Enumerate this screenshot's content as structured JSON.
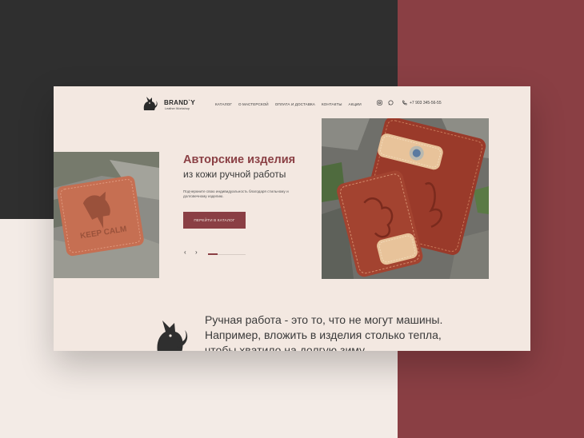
{
  "brand": {
    "name": "BRAND`Y",
    "tagline": "Leather Workshop"
  },
  "nav": {
    "items": [
      {
        "label": "КАТАЛОГ"
      },
      {
        "label": "О МАСТЕРСКОЙ"
      },
      {
        "label": "ОПЛАТА И ДОСТАВКА"
      },
      {
        "label": "КОНТАКТЫ"
      },
      {
        "label": "АКЦИИ"
      }
    ]
  },
  "header": {
    "icons": [
      "instagram-icon",
      "whatsapp-icon",
      "phone-icon"
    ],
    "phone": "+7 903 345-56-55"
  },
  "hero": {
    "title": "Авторские изделия",
    "subtitle": "из кожи ручной работы",
    "description": "Подчеркните свою индивидуальность благодаря стильному и долговечному изделию.",
    "cta_label": "ПЕРЕЙТИ В КАТАЛОГ",
    "left_image_text": "KEEP CALM",
    "slider": {
      "prev": "‹",
      "next": "›",
      "position": 0.25
    }
  },
  "about": {
    "quote": "Ручная работа - это то, что не могут машины. Например, вложить в изделия столько тепла, чтобы хватило на долгую зиму."
  },
  "colors": {
    "accent": "#8a3f44",
    "dark": "#2f2f2f",
    "cream": "#f3e8e1"
  }
}
